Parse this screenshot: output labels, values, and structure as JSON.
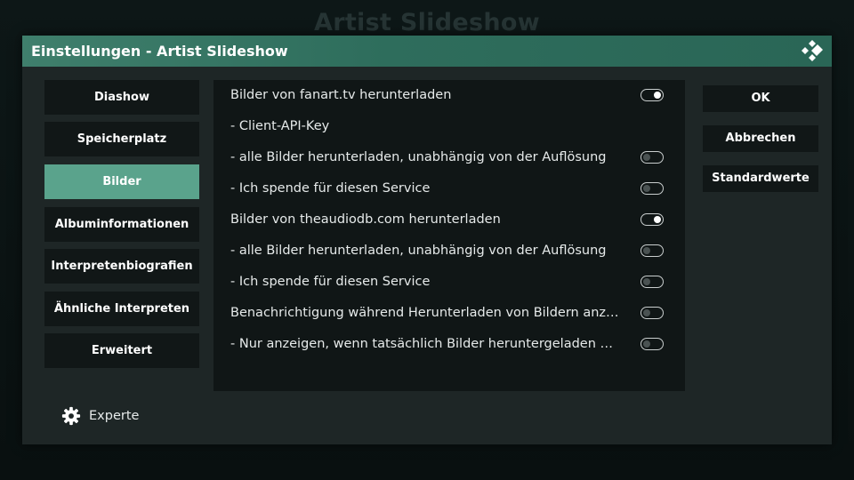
{
  "background": {
    "title": "Artist Slideshow"
  },
  "dialog": {
    "title": "Einstellungen - Artist Slideshow",
    "logo_icon": "kodi-logo-icon"
  },
  "categories": [
    {
      "label": "Diashow",
      "selected": false
    },
    {
      "label": "Speicherplatz",
      "selected": false
    },
    {
      "label": "Bilder",
      "selected": true
    },
    {
      "label": "Albuminformationen",
      "selected": false
    },
    {
      "label": "Interpretenbiografien",
      "selected": false
    },
    {
      "label": "Ähnliche Interpreten",
      "selected": false
    },
    {
      "label": "Erweitert",
      "selected": false
    }
  ],
  "settings": [
    {
      "label": "Bilder von fanart.tv herunterladen",
      "type": "toggle",
      "value": true
    },
    {
      "label": "- Client-API-Key",
      "type": "text"
    },
    {
      "label": "- alle Bilder herunterladen, unabhängig von der Auflösung",
      "type": "toggle",
      "value": false
    },
    {
      "label": "- Ich spende für diesen Service",
      "type": "toggle",
      "value": false
    },
    {
      "label": "Bilder von theaudiodb.com herunterladen",
      "type": "toggle",
      "value": true
    },
    {
      "label": "- alle Bilder herunterladen, unabhängig von der Auflösung",
      "type": "toggle",
      "value": false
    },
    {
      "label": "- Ich spende für diesen Service",
      "type": "toggle",
      "value": false
    },
    {
      "label": "Benachrichtigung während Herunterladen von Bildern anzeigen",
      "type": "toggle",
      "value": false
    },
    {
      "label": "- Nur anzeigen, wenn tatsächlich Bilder heruntergeladen werde...",
      "type": "toggle",
      "value": false
    }
  ],
  "actions": {
    "ok": "OK",
    "cancel": "Abbrechen",
    "defaults": "Standardwerte"
  },
  "level": {
    "label": "Experte",
    "icon": "gear-icon"
  },
  "colors": {
    "accent": "#5aa38c",
    "header": "#3f7f6c"
  }
}
